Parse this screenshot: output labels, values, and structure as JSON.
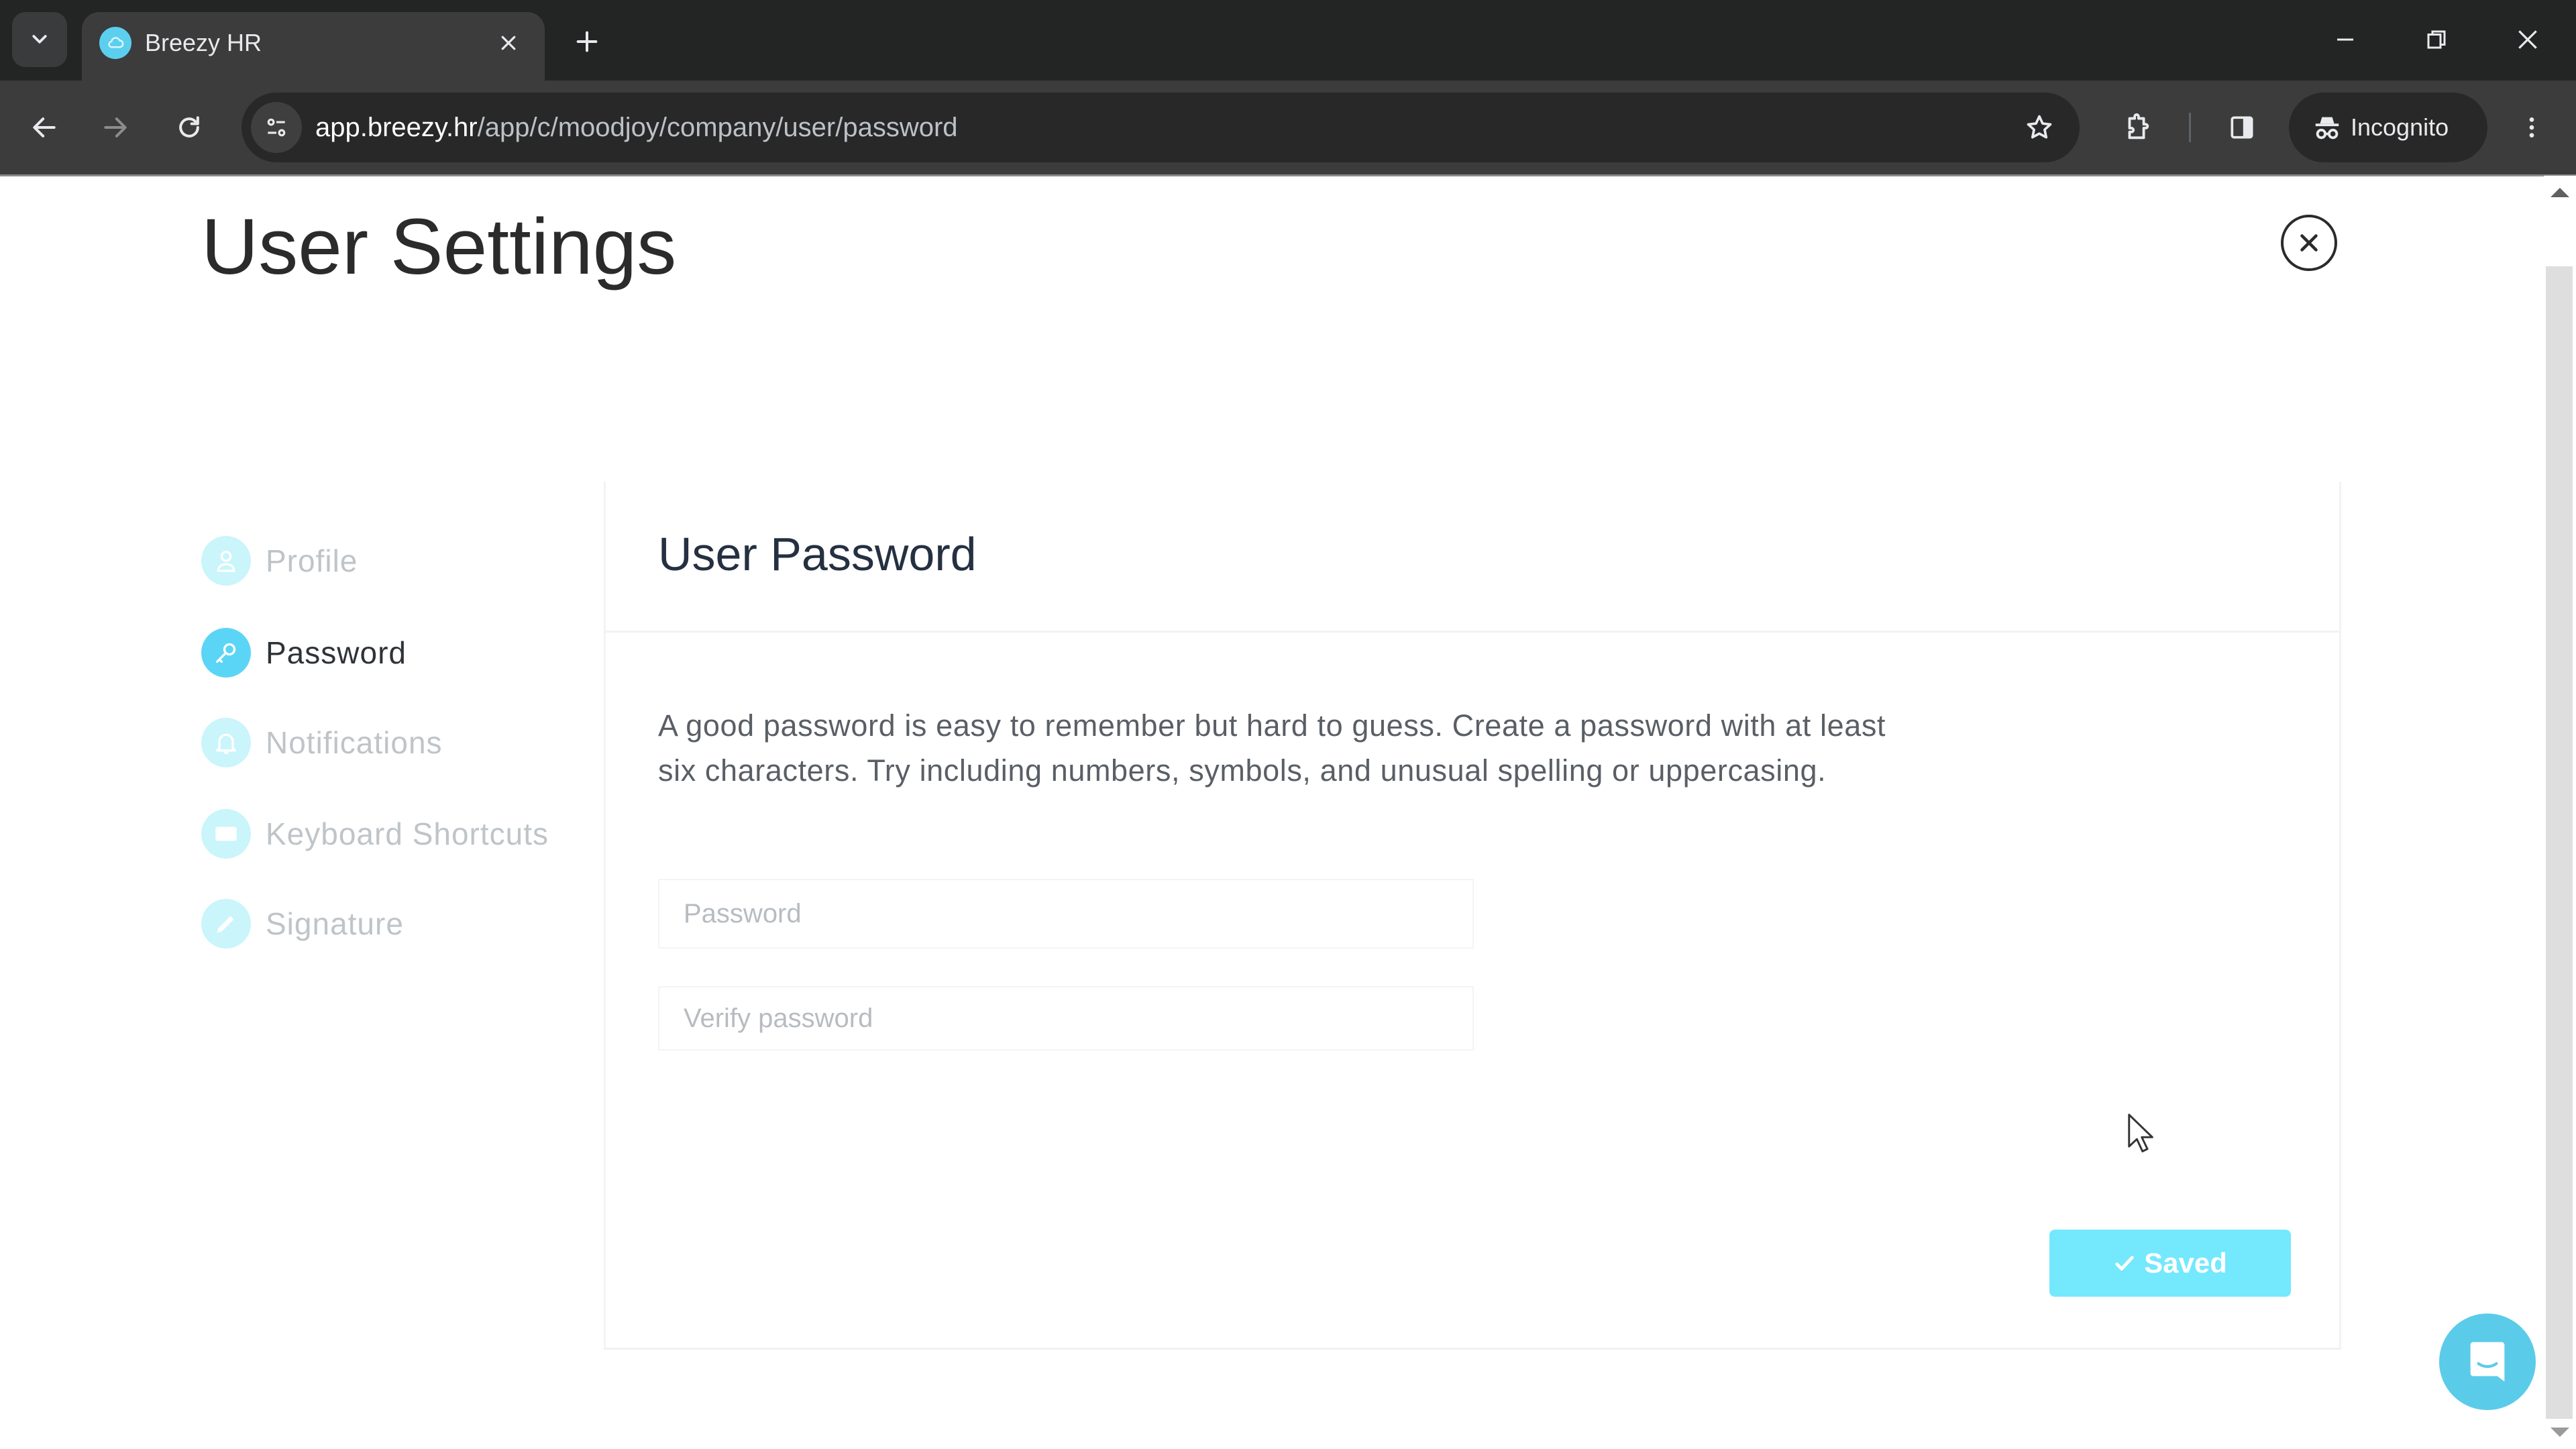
{
  "browser": {
    "tab_title": "Breezy HR",
    "url_host": "app.breezy.hr",
    "url_path": "/app/c/moodjoy/company/user/password",
    "incognito_label": "Incognito",
    "icons": {
      "tab_search": "chevron-down-icon",
      "favicon": "breezy-cloud-icon",
      "tab_close": "close-icon",
      "new_tab": "plus-icon",
      "minimize": "minimize-icon",
      "restore": "restore-icon",
      "window_close": "close-icon",
      "back": "arrow-left-icon",
      "forward": "arrow-right-icon",
      "reload": "reload-icon",
      "site_info": "tune-icon",
      "bookmark": "star-icon",
      "extensions": "puzzle-icon",
      "side_panel": "side-panel-icon",
      "incognito": "incognito-icon",
      "menu": "kebab-menu-icon"
    }
  },
  "page": {
    "title": "User Settings",
    "close_icon": "close-circle-icon"
  },
  "sidebar": {
    "items": [
      {
        "label": "Profile",
        "icon": "user-icon",
        "active": false
      },
      {
        "label": "Password",
        "icon": "key-icon",
        "active": true
      },
      {
        "label": "Notifications",
        "icon": "bell-icon",
        "active": false
      },
      {
        "label": "Keyboard Shortcuts",
        "icon": "keyboard-icon",
        "active": false
      },
      {
        "label": "Signature",
        "icon": "pencil-icon",
        "active": false
      }
    ]
  },
  "panel": {
    "title": "User Password",
    "description": "A good password is easy to remember but hard to guess. Create a password with at least six characters. Try including numbers, symbols, and unusual spelling or uppercasing.",
    "password_field": {
      "value": "",
      "placeholder": "Password"
    },
    "verify_field": {
      "value": "",
      "placeholder": "Verify password"
    },
    "save_button_label": "Saved",
    "save_button_icon": "checkmark-icon"
  },
  "chat_widget": {
    "icon": "chat-bubble-icon"
  },
  "colors": {
    "accent": "#5bd5f5",
    "accent_light": "#c9f5fb",
    "saved_button": "#74e8fd",
    "chat_button": "#5bcbea",
    "chrome_dark": "#232525",
    "chrome_toolbar": "#3c3c3c"
  }
}
